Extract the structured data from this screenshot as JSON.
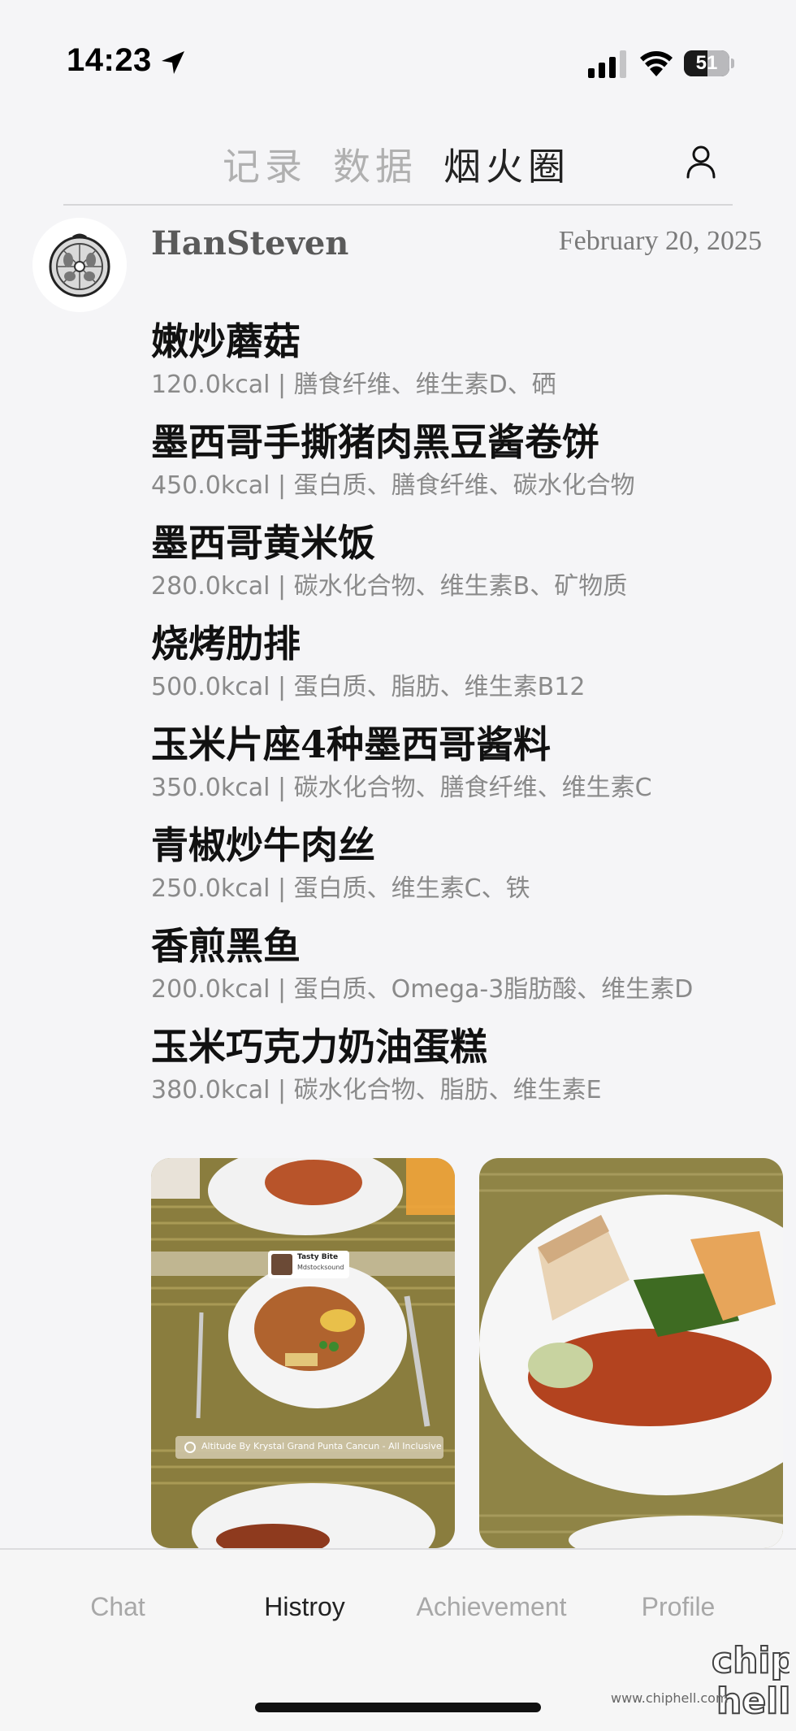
{
  "status_bar": {
    "time": "14:23",
    "battery": "51",
    "battery_level_percent": 51,
    "icons": [
      "location-arrow-icon",
      "cellular-signal-icon",
      "wifi-icon",
      "battery-icon"
    ]
  },
  "top_tabs": {
    "items": [
      {
        "label": "记录",
        "active": false
      },
      {
        "label": "数据",
        "active": false
      },
      {
        "label": "烟火圈",
        "active": true
      }
    ],
    "profile_icon": "user-icon"
  },
  "post": {
    "username": "HanSteven",
    "date": "February 20, 2025",
    "avatar_icon": "tomato-sketch-avatar",
    "foods": [
      {
        "name": "嫩炒蘑菇",
        "info": "120.0kcal | 膳食纤维、维生素D、硒"
      },
      {
        "name": "墨西哥手撕猪肉黑豆酱卷饼",
        "info": "450.0kcal | 蛋白质、膳食纤维、碳水化合物"
      },
      {
        "name": "墨西哥黄米饭",
        "info": "280.0kcal | 碳水化合物、维生素B、矿物质"
      },
      {
        "name": "烧烤肋排",
        "info": "500.0kcal | 蛋白质、脂肪、维生素B12"
      },
      {
        "name": "玉米片座4种墨西哥酱料",
        "info": "350.0kcal | 碳水化合物、膳食纤维、维生素C"
      },
      {
        "name": "青椒炒牛肉丝",
        "info": "250.0kcal | 蛋白质、维生素C、铁"
      },
      {
        "name": "香煎黑鱼",
        "info": "200.0kcal | 蛋白质、Omega-3脂肪酸、维生素D"
      },
      {
        "name": "玉米巧克力奶油蛋糕",
        "info": "380.0kcal | 碳水化合物、脂肪、维生素E"
      }
    ],
    "photo_1": {
      "badge_title": "Tasty Bite",
      "badge_sub": "Mdstocksound",
      "location_text": "Altitude By Krystal Grand Punta Cancun - All Inclusive"
    }
  },
  "bottom_nav": {
    "items": [
      {
        "label": "Chat",
        "active": false
      },
      {
        "label": "Histroy",
        "active": true
      },
      {
        "label": "Achievement",
        "active": false
      },
      {
        "label": "Profile",
        "active": false
      }
    ]
  },
  "watermark": {
    "text": "www.chiphell.com",
    "logo_text": "chip hell"
  }
}
